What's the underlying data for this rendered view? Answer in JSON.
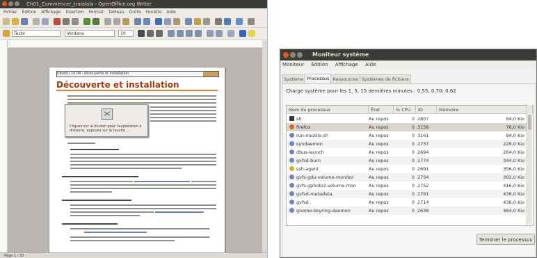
{
  "writer": {
    "title": "Ch01_Commencer_tralalala - OpenOffice.org Writer",
    "menu": [
      "Fichier",
      "Édition",
      "Affichage",
      "Insertion",
      "Format",
      "Tableau",
      "Outils",
      "Fenêtre",
      "Aide"
    ],
    "style_value": "Texte",
    "font_value": "Verdana",
    "size_value": "10",
    "header_text": "Ubuntu 10.04 : découverte et installation",
    "heading": "Découverte et installation",
    "dialog_text": "Cliquez sur le bouton pour l'exploration à distance, appuyez sur la touche ...",
    "status": "Page 1 / 30"
  },
  "monitor": {
    "title": "Moniteur système",
    "menu": [
      "Moniteur",
      "Édition",
      "Affichage",
      "Aide"
    ],
    "tabs": [
      "Système",
      "Processus",
      "Ressources",
      "Systèmes de fichiers"
    ],
    "active_tab": "Processus",
    "load": "Charge système pour les 1, 5, 15 dernières minutes : 0,55; 0,70; 0,62",
    "columns": [
      "Nom du processus",
      "État",
      "% CPU",
      "ID",
      "Mémoire"
    ],
    "processes": [
      {
        "name": "sh",
        "state": "Au repos",
        "cpu": "0",
        "id": "2807",
        "mem": "64,0 Kio",
        "icon": "terminal-icon"
      },
      {
        "name": "firefox",
        "state": "Au repos",
        "cpu": "0",
        "id": "3156",
        "mem": "76,0 Kio",
        "icon": "firefox-icon"
      },
      {
        "name": "run-mozilla.sh",
        "state": "Au repos",
        "cpu": "0",
        "id": "3161",
        "mem": "84,0 Kio",
        "icon": "gear-icon"
      },
      {
        "name": "syndaemon",
        "state": "Au repos",
        "cpu": "0",
        "id": "2737",
        "mem": "228,0 Kio",
        "icon": "gear-icon"
      },
      {
        "name": "dbus-launch",
        "state": "Au repos",
        "cpu": "0",
        "id": "2694",
        "mem": "264,0 Kio",
        "icon": "gear-icon"
      },
      {
        "name": "gvfsd-burn",
        "state": "Au repos",
        "cpu": "0",
        "id": "2774",
        "mem": "344,0 Kio",
        "icon": "gear-icon"
      },
      {
        "name": "ssh-agent",
        "state": "Au repos",
        "cpu": "0",
        "id": "2691",
        "mem": "356,0 Kio",
        "icon": "key-icon"
      },
      {
        "name": "gvfs-gdu-volume-monitor",
        "state": "Au repos",
        "cpu": "0",
        "id": "2754",
        "mem": "392,0 Kio",
        "icon": "gear-icon"
      },
      {
        "name": "gvfs-gphoto2-volume-mon",
        "state": "Au repos",
        "cpu": "0",
        "id": "2752",
        "mem": "416,0 Kio",
        "icon": "gear-icon"
      },
      {
        "name": "gvfsd-metadata",
        "state": "Au repos",
        "cpu": "0",
        "id": "2781",
        "mem": "436,0 Kio",
        "icon": "gear-icon"
      },
      {
        "name": "gvfsd",
        "state": "Au repos",
        "cpu": "0",
        "id": "2714",
        "mem": "436,0 Kio",
        "icon": "gear-icon"
      },
      {
        "name": "gnome-keyring-daemon",
        "state": "Au repos",
        "cpu": "0",
        "id": "2638",
        "mem": "464,0 Kio",
        "icon": "gear-icon"
      }
    ],
    "end_button": "Terminer le processus"
  }
}
